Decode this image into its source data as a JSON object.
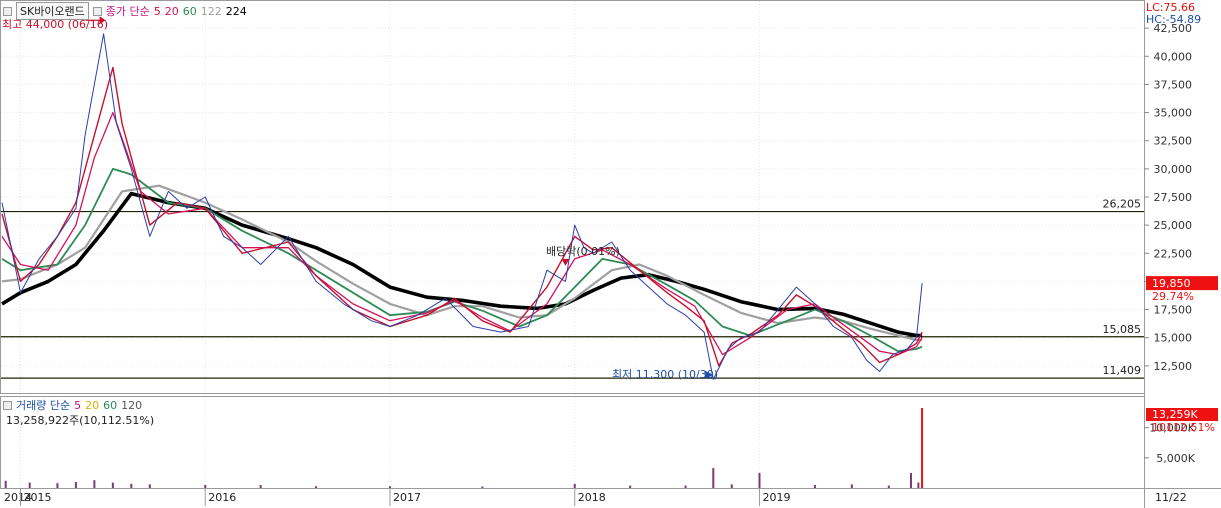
{
  "stock_name": "SK바이오랜드",
  "price_legend": {
    "label": "종가 단순",
    "ma_periods": [
      "5",
      "20",
      "60",
      "122",
      "224"
    ],
    "ma_colors": [
      "#c8102e",
      "#d4145a",
      "#2e8b57",
      "#a0a0a0",
      "#000000"
    ]
  },
  "volume_legend": {
    "label": "거래량 단순",
    "ma_periods": [
      "5",
      "20",
      "60",
      "120"
    ],
    "ma_colors": [
      "#c71585",
      "#e0b000",
      "#2e8b57",
      "#555555"
    ],
    "current_volume_text": "13,258,922주(10,112.51%)"
  },
  "right_info": {
    "lc": "LC:75.66",
    "hc": "HC:-54.89"
  },
  "annotations": {
    "high": "최고 44,000 (06/16)",
    "low": "최저 11,300 (10/30)",
    "dividend": "배당락(0.01%)"
  },
  "date_footer": "11/22",
  "chart_data": {
    "type": "line",
    "price_axis": {
      "ylim": [
        10000,
        45000
      ],
      "ticks": [
        12500,
        15000,
        17500,
        20000,
        22500,
        25000,
        27500,
        30000,
        32500,
        35000,
        37500,
        40000,
        42500
      ],
      "tick_labels": [
        "12,500",
        "15,000",
        "17,500",
        "20,000",
        "22,500",
        "25,000",
        "27,500",
        "30,000",
        "32,500",
        "35,000",
        "37,500",
        "40,000",
        "42,500"
      ]
    },
    "volume_axis": {
      "ylim": [
        0,
        13260000
      ],
      "ticks": [
        5000000,
        10000000
      ],
      "tick_labels": [
        "5,000K",
        "10,000K"
      ]
    },
    "x_axis": {
      "xlim": [
        2014.9,
        2019.95
      ],
      "year_ticks": [
        2015.0,
        2016.0,
        2017.0,
        2018.0,
        2019.0
      ],
      "year_labels": [
        "2015",
        "2016",
        "2017",
        "2018",
        "2019"
      ],
      "first_label": "2014"
    },
    "horizontal_lines": [
      {
        "value": 26205,
        "label": "26,205"
      },
      {
        "value": 15085,
        "label": "15,085"
      },
      {
        "value": 11409,
        "label": "11,409"
      }
    ],
    "current_price": {
      "value": 19850,
      "label": "19,850",
      "change": "29.74%"
    },
    "current_volume": {
      "value": 13259000,
      "label": "13,259K",
      "change": "10112.51%"
    },
    "price_series": {
      "name": "종가",
      "x": [
        2014.9,
        2015.0,
        2015.1,
        2015.2,
        2015.3,
        2015.35,
        2015.45,
        2015.52,
        2015.6,
        2015.7,
        2015.8,
        2015.9,
        2016.0,
        2016.1,
        2016.2,
        2016.3,
        2016.45,
        2016.6,
        2016.75,
        2016.9,
        2017.0,
        2017.15,
        2017.3,
        2017.45,
        2017.6,
        2017.75,
        2017.85,
        2017.95,
        2018.0,
        2018.05,
        2018.1,
        2018.2,
        2018.3,
        2018.4,
        2018.5,
        2018.6,
        2018.7,
        2018.75,
        2018.83,
        2018.9,
        2019.0,
        2019.1,
        2019.2,
        2019.3,
        2019.4,
        2019.5,
        2019.58,
        2019.65,
        2019.72,
        2019.8,
        2019.85,
        2019.88
      ],
      "values": [
        27000,
        19000,
        22000,
        24000,
        26500,
        33000,
        42000,
        34000,
        30000,
        24000,
        28000,
        26500,
        27500,
        24000,
        23000,
        21500,
        24000,
        20000,
        18000,
        16500,
        16000,
        17000,
        18500,
        16000,
        15500,
        16000,
        21000,
        20000,
        25000,
        23000,
        22500,
        23500,
        21000,
        19500,
        18000,
        17000,
        15500,
        11300,
        14000,
        15000,
        15500,
        17500,
        19500,
        18000,
        16000,
        15000,
        13000,
        12000,
        13500,
        14000,
        15000,
        19850
      ]
    },
    "ma_series": [
      {
        "name": "5",
        "x": [
          2014.9,
          2015.0,
          2015.1,
          2015.2,
          2015.3,
          2015.4,
          2015.5,
          2015.55,
          2015.7,
          2015.85,
          2016.0,
          2016.2,
          2016.45,
          2016.6,
          2016.8,
          2017.0,
          2017.2,
          2017.35,
          2017.5,
          2017.65,
          2017.85,
          2018.0,
          2018.1,
          2018.2,
          2018.35,
          2018.5,
          2018.6,
          2018.7,
          2018.78,
          2018.85,
          2018.95,
          2019.1,
          2019.2,
          2019.3,
          2019.45,
          2019.55,
          2019.65,
          2019.75,
          2019.85,
          2019.88
        ],
        "values": [
          26000,
          20000,
          21500,
          24000,
          27000,
          33000,
          39000,
          34000,
          25000,
          27000,
          26500,
          22500,
          23500,
          20500,
          17500,
          16000,
          17000,
          18500,
          16500,
          15500,
          19500,
          24000,
          22800,
          23000,
          21000,
          19000,
          17800,
          16500,
          12500,
          14500,
          15300,
          17000,
          18800,
          17800,
          15800,
          14500,
          12800,
          13500,
          14500,
          15500
        ]
      },
      {
        "name": "20",
        "x": [
          2014.9,
          2015.0,
          2015.15,
          2015.3,
          2015.4,
          2015.5,
          2015.65,
          2015.8,
          2016.0,
          2016.2,
          2016.45,
          2016.6,
          2016.8,
          2017.0,
          2017.2,
          2017.35,
          2017.5,
          2017.65,
          2017.85,
          2018.0,
          2018.15,
          2018.3,
          2018.5,
          2018.65,
          2018.8,
          2018.95,
          2019.15,
          2019.3,
          2019.45,
          2019.55,
          2019.65,
          2019.75,
          2019.85,
          2019.88
        ],
        "values": [
          24000,
          21500,
          21000,
          25000,
          31000,
          35000,
          28000,
          26000,
          26500,
          23000,
          23000,
          20500,
          18000,
          16500,
          17200,
          18300,
          16800,
          15600,
          18000,
          22000,
          22800,
          21500,
          19300,
          17800,
          13500,
          15000,
          17500,
          18000,
          16200,
          15000,
          13800,
          13500,
          14200,
          15000
        ]
      },
      {
        "name": "60",
        "x": [
          2014.9,
          2015.0,
          2015.2,
          2015.35,
          2015.5,
          2015.6,
          2015.8,
          2016.0,
          2016.2,
          2016.45,
          2016.6,
          2016.8,
          2017.0,
          2017.2,
          2017.35,
          2017.5,
          2017.7,
          2017.85,
          2018.0,
          2018.15,
          2018.3,
          2018.5,
          2018.65,
          2018.8,
          2018.95,
          2019.15,
          2019.3,
          2019.45,
          2019.6,
          2019.75,
          2019.85,
          2019.88
        ],
        "values": [
          22000,
          21000,
          21500,
          25000,
          30000,
          29500,
          27000,
          26500,
          24500,
          22500,
          21000,
          19000,
          17000,
          17300,
          18200,
          17400,
          16000,
          17000,
          19500,
          22000,
          21500,
          19700,
          18300,
          16000,
          15200,
          16500,
          17500,
          16500,
          15200,
          13800,
          14000,
          14200
        ]
      },
      {
        "name": "122",
        "x": [
          2014.9,
          2015.0,
          2015.2,
          2015.35,
          2015.55,
          2015.75,
          2016.0,
          2016.2,
          2016.45,
          2016.6,
          2016.8,
          2017.0,
          2017.2,
          2017.35,
          2017.5,
          2017.7,
          2017.85,
          2018.0,
          2018.2,
          2018.35,
          2018.5,
          2018.7,
          2018.9,
          2019.1,
          2019.3,
          2019.45,
          2019.6,
          2019.75,
          2019.85,
          2019.88
        ],
        "values": [
          20000,
          20200,
          21500,
          23000,
          28000,
          28500,
          27000,
          25500,
          23500,
          21800,
          19800,
          18000,
          17000,
          17800,
          17800,
          16800,
          17000,
          18500,
          21000,
          21500,
          20500,
          18800,
          17200,
          16300,
          16800,
          16500,
          15800,
          15200,
          14800,
          14800
        ]
      },
      {
        "name": "224",
        "x": [
          2014.9,
          2015.0,
          2015.15,
          2015.3,
          2015.45,
          2015.6,
          2015.8,
          2016.0,
          2016.2,
          2016.45,
          2016.6,
          2016.8,
          2017.0,
          2017.2,
          2017.4,
          2017.6,
          2017.8,
          2017.95,
          2018.1,
          2018.25,
          2018.4,
          2018.55,
          2018.7,
          2018.9,
          2019.1,
          2019.3,
          2019.45,
          2019.6,
          2019.75,
          2019.85,
          2019.88
        ],
        "values": [
          18000,
          19000,
          20000,
          21500,
          24500,
          27800,
          27000,
          26500,
          25000,
          23800,
          23000,
          21500,
          19500,
          18600,
          18300,
          17800,
          17600,
          18000,
          19200,
          20300,
          20600,
          20000,
          19300,
          18200,
          17500,
          17600,
          17100,
          16300,
          15500,
          15200,
          15200
        ]
      }
    ],
    "volume_series": {
      "name": "거래량",
      "x": [
        2014.92,
        2015.05,
        2015.2,
        2015.3,
        2015.4,
        2015.5,
        2015.6,
        2015.7,
        2016.0,
        2016.3,
        2016.6,
        2017.0,
        2017.5,
        2018.0,
        2018.3,
        2018.6,
        2018.75,
        2018.85,
        2019.0,
        2019.3,
        2019.5,
        2019.7,
        2019.82,
        2019.86,
        2019.88
      ],
      "values": [
        1200000,
        900000,
        800000,
        1000000,
        1300000,
        900000,
        700000,
        600000,
        500000,
        500000,
        300000,
        300000,
        250000,
        700000,
        400000,
        400000,
        3300000,
        600000,
        2500000,
        500000,
        600000,
        400000,
        2500000,
        900000,
        13259000
      ]
    }
  }
}
